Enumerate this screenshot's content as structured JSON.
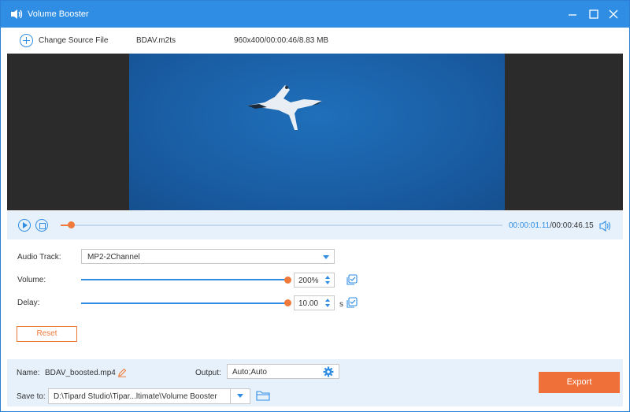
{
  "window": {
    "title": "Volume Booster"
  },
  "source": {
    "change_label": "Change Source File",
    "file_name": "BDAV.m2ts",
    "file_info": "960x400/00:00:46/8.83 MB"
  },
  "playback": {
    "current_time": "00:00:01.11",
    "total_time": "/00:00:46.15",
    "progress_fraction": 0.024
  },
  "settings": {
    "audio_track_label": "Audio Track:",
    "audio_track_value": "MP2-2Channel",
    "volume_label": "Volume:",
    "volume_value": "200%",
    "volume_fraction": 1.0,
    "delay_label": "Delay:",
    "delay_value": "10.00",
    "delay_unit": "s",
    "delay_fraction": 1.0,
    "reset_label": "Reset"
  },
  "output": {
    "name_label": "Name:",
    "name_value": "BDAV_boosted.mp4",
    "output_label": "Output:",
    "output_value": "Auto;Auto",
    "save_to_label": "Save to:",
    "save_to_value": "D:\\Tipard Studio\\Tipar...ltimate\\Volume Booster",
    "export_label": "Export"
  },
  "colors": {
    "accent": "#2f8de4",
    "orange": "#f07a3b",
    "panel": "#e6f1fb"
  }
}
